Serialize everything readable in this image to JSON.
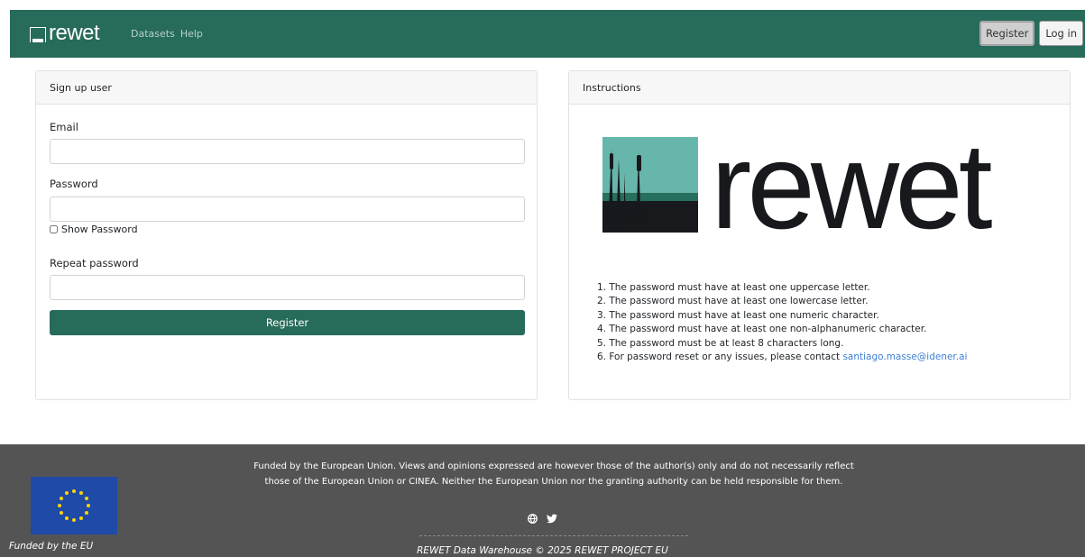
{
  "nav": {
    "brand": "rewet",
    "links": [
      "Datasets",
      "Help"
    ],
    "register_label": "Register",
    "login_label": "Log in",
    "colors": {
      "primary": "#276b5a",
      "footer": "#545454",
      "link": "#3d7fd6"
    }
  },
  "signup": {
    "title": "Sign up user",
    "email_label": "Email",
    "email_value": "",
    "password_label": "Password",
    "password_value": "",
    "show_password_label": "Show Password",
    "show_password_checked": false,
    "repeat_label": "Repeat password",
    "repeat_value": "",
    "submit_label": "Register"
  },
  "instructions": {
    "title": "Instructions",
    "logo_text": "rewet",
    "rules": [
      "1. The password must have at least one uppercase letter.",
      "2. The password must have at least one lowercase letter.",
      "3. The password must have at least one numeric character.",
      "4. The password must have at least one non-alphanumeric character.",
      "5. The password must be at least 8 characters long.",
      "6. For password reset or any issues, please contact "
    ],
    "contact_email": "santiago.masse@idener.ai"
  },
  "footer": {
    "disclaimer": "Funded by the European Union. Views and opinions expressed are however those of the author(s) only and do not necessarily reflect those of the European Union or CINEA. Neither the European Union nor the granting authority can be held responsible for them.",
    "eu_caption": "Funded by the EU",
    "social_icons": [
      "globe-icon",
      "twitter-icon"
    ],
    "copyright": "REWET Data Warehouse © 2025 REWET PROJECT EU"
  }
}
